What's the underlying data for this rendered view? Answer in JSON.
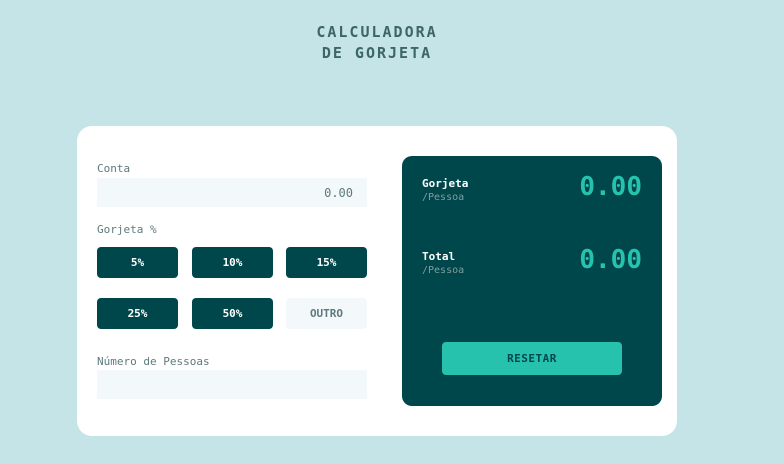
{
  "header": {
    "title_line1": "CALCULADORA",
    "title_line2": "DE GORJETA"
  },
  "form": {
    "bill_label": "Conta",
    "bill_placeholder": "0.00",
    "tip_label": "Gorjeta %",
    "tip_options": [
      "5%",
      "10%",
      "15%",
      "25%",
      "50%"
    ],
    "custom_placeholder": "OUTRO",
    "people_label": "Número de Pessoas",
    "people_placeholder": ""
  },
  "results": {
    "tip_title": "Gorjeta",
    "tip_sub": "/Pessoa",
    "tip_amount": "0.00",
    "total_title": "Total",
    "total_sub": "/Pessoa",
    "total_amount": "0.00",
    "reset_label": "RESETAR"
  },
  "colors": {
    "background": "#c5e4e7",
    "dark_cyan": "#00474b",
    "strong_cyan": "#26c2ae",
    "input_bg": "#f3f8fb"
  }
}
